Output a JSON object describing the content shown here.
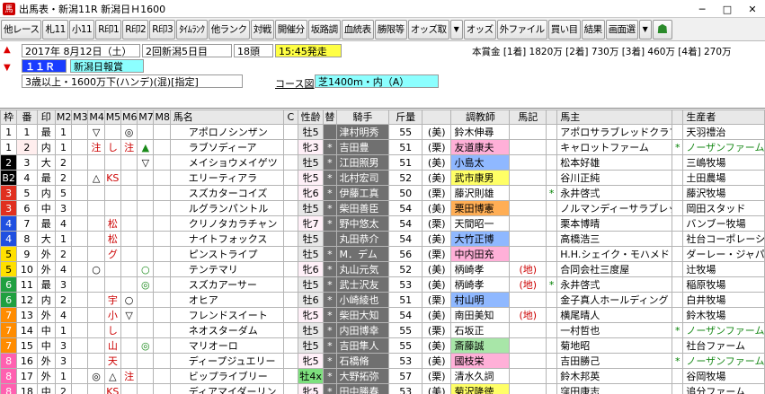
{
  "window": {
    "title": "出馬表・新潟11R 新潟日Ｈ1600",
    "minimize": "─",
    "maximize": "□",
    "close": "✕"
  },
  "toolbar": [
    "他レース",
    "札11",
    "小11",
    "R印1",
    "R印2",
    "R印3",
    "ﾀｲﾑﾗﾝｸ",
    "他ランク",
    "対戦",
    "開催分",
    "坂路調",
    "血統表",
    "勝限等",
    "オッズ取",
    "オッズ",
    "外ファイル",
    "買い目",
    "結果",
    "画面選"
  ],
  "race": {
    "date": "2017年 8月12日（土）",
    "meet": "2回新潟5日目",
    "heads": "18頭",
    "post_time": "15:45発走",
    "race_no": "１１Ｒ",
    "race_name": "新潟日報賞",
    "conditions": "3歳以上・1600万下(ハンデ)(混)[指定]",
    "course_label": "コース図",
    "course": "芝1400m・内（A）",
    "prize": "本賞金 [1着] 1820万 [2着] 730万 [3着] 460万 [4着] 270万"
  },
  "headers": [
    "枠",
    "番",
    "印",
    "M2",
    "M3",
    "M4",
    "M5",
    "M6",
    "M7",
    "M8",
    "馬名",
    "C",
    "性齢",
    "替",
    "騎手",
    "斤量",
    "",
    "調教師",
    "馬記",
    "",
    "馬主",
    "",
    "生産者"
  ],
  "colors": {
    "accent_red": "#cc0000",
    "frame1": "#ffffff",
    "frame2": "#000000",
    "frame3": "#e03020",
    "frame4": "#2050e0",
    "frame5": "#ffe000",
    "frame6": "#20a040",
    "frame7": "#ff8c00",
    "frame8": "#ff60b0"
  },
  "rows": [
    {
      "waku": "1",
      "num": "1",
      "in": "最",
      "m2": "1",
      "m3": "",
      "m4": "▽",
      "m5": "",
      "m6": "◎",
      "m7": "",
      "m8": "",
      "name": "アポロノシンザン",
      "c": "",
      "sex": "牡5",
      "chg": "",
      "jockey": "津村明秀",
      "kin": "55",
      "area": "(美)",
      "trainer": "鈴木伸尋",
      "tkg": "",
      "own_mark": "",
      "owner": "アポロサラブレッドクラブ",
      "prd_mark": "",
      "producer": "天羽禮治"
    },
    {
      "waku": "1",
      "num": "2",
      "in": "内",
      "m2": "1",
      "m3": "",
      "m4": "注",
      "m5": "し",
      "m6": "注",
      "m7": "▲",
      "m8": "",
      "name": "ラブソディーア",
      "c": "",
      "sex": "牝3",
      "chg": "*",
      "jockey": "吉田豊",
      "kin": "51",
      "area": "(栗)",
      "trainer": "友道康夫",
      "tkg": "",
      "own_mark": "",
      "owner": "キャロットファーム",
      "prd_mark": "*",
      "producer": "ノーザンファーム"
    },
    {
      "waku": "2",
      "num": "3",
      "in": "大",
      "m2": "2",
      "m3": "",
      "m4": "",
      "m5": "",
      "m6": "",
      "m7": "▽",
      "m8": "",
      "name": "メイショウメイゲツ",
      "c": "",
      "sex": "牡5",
      "chg": "*",
      "jockey": "江田照男",
      "kin": "51",
      "area": "(美)",
      "trainer": "小島太",
      "tkg": "",
      "own_mark": "",
      "owner": "松本好雄",
      "prd_mark": "",
      "producer": "三嶋牧場"
    },
    {
      "waku": "B2",
      "num": "4",
      "in": "最",
      "m2": "2",
      "m3": "",
      "m4": "△",
      "m5": "KS",
      "m6": "",
      "m7": "",
      "m8": "",
      "name": "エリーティアラ",
      "c": "",
      "sex": "牝5",
      "chg": "*",
      "jockey": "北村宏司",
      "kin": "52",
      "area": "(美)",
      "trainer": "武市康男",
      "tkg": "",
      "own_mark": "",
      "owner": "谷川正純",
      "prd_mark": "",
      "producer": "土田農場"
    },
    {
      "waku": "3",
      "num": "5",
      "in": "内",
      "m2": "5",
      "m3": "",
      "m4": "",
      "m5": "",
      "m6": "",
      "m7": "",
      "m8": "",
      "name": "スズカターコイズ",
      "c": "",
      "sex": "牝6",
      "chg": "*",
      "jockey": "伊藤工真",
      "kin": "50",
      "area": "(栗)",
      "trainer": "藤沢則雄",
      "tkg": "",
      "own_mark": "*",
      "owner": "永井啓弍",
      "prd_mark": "",
      "producer": "藤沢牧場"
    },
    {
      "waku": "3",
      "num": "6",
      "in": "中",
      "m2": "3",
      "m3": "",
      "m4": "",
      "m5": "",
      "m6": "",
      "m7": "",
      "m8": "",
      "name": "ルグランパントル",
      "c": "",
      "sex": "牡5",
      "chg": "*",
      "jockey": "柴田善臣",
      "kin": "54",
      "area": "(美)",
      "trainer": "栗田博憲",
      "tkg": "",
      "own_mark": "",
      "owner": "ノルマンディーサラブレッド",
      "prd_mark": "",
      "producer": "岡田スタッド"
    },
    {
      "waku": "4",
      "num": "7",
      "in": "最",
      "m2": "4",
      "m3": "",
      "m4": "",
      "m5": "松",
      "m6": "",
      "m7": "",
      "m8": "",
      "name": "クリノタカラチャン",
      "c": "",
      "sex": "牝7",
      "chg": "*",
      "jockey": "野中悠太",
      "kin": "54",
      "area": "(栗)",
      "trainer": "天間昭一",
      "tkg": "",
      "own_mark": "",
      "owner": "栗本博晴",
      "prd_mark": "",
      "producer": "バンブー牧場"
    },
    {
      "waku": "4",
      "num": "8",
      "in": "大",
      "m2": "1",
      "m3": "",
      "m4": "",
      "m5": "松",
      "m6": "",
      "m7": "",
      "m8": "",
      "name": "ナイトフォックス",
      "c": "",
      "sex": "牡5",
      "chg": "",
      "jockey": "丸田恭介",
      "kin": "54",
      "area": "(美)",
      "trainer": "大竹正博",
      "tkg": "",
      "own_mark": "",
      "owner": "高橋浩三",
      "prd_mark": "",
      "producer": "社台コーポレーション"
    },
    {
      "waku": "5",
      "num": "9",
      "in": "外",
      "m2": "2",
      "m3": "",
      "m4": "",
      "m5": "グ",
      "m6": "",
      "m7": "",
      "m8": "",
      "name": "ピンストライプ",
      "c": "",
      "sex": "牡5",
      "chg": "*",
      "jockey": "M．デム",
      "kin": "56",
      "area": "(栗)",
      "trainer": "中内田充",
      "tkg": "",
      "own_mark": "",
      "owner": "H.H.シェイク・モハメド",
      "prd_mark": "",
      "producer": "ダーレー・ジャパン"
    },
    {
      "waku": "5",
      "num": "10",
      "in": "外",
      "m2": "4",
      "m3": "",
      "m4": "○",
      "m5": "",
      "m6": "",
      "m7": "○",
      "m8": "",
      "name": "テンテマリ",
      "c": "",
      "sex": "牝6",
      "chg": "*",
      "jockey": "丸山元気",
      "kin": "52",
      "area": "(美)",
      "trainer": "柄崎孝",
      "tkg": "(地)",
      "own_mark": "",
      "owner": "合同会社三度屋",
      "prd_mark": "",
      "producer": "辻牧場"
    },
    {
      "waku": "6",
      "num": "11",
      "in": "最",
      "m2": "3",
      "m3": "",
      "m4": "",
      "m5": "",
      "m6": "",
      "m7": "◎",
      "m8": "",
      "name": "スズカアーサー",
      "c": "",
      "sex": "牡5",
      "chg": "*",
      "jockey": "武士沢友",
      "kin": "53",
      "area": "(美)",
      "trainer": "柄崎孝",
      "tkg": "(地)",
      "own_mark": "*",
      "owner": "永井啓弍",
      "prd_mark": "",
      "producer": "稲原牧場"
    },
    {
      "waku": "6",
      "num": "12",
      "in": "内",
      "m2": "2",
      "m3": "",
      "m4": "",
      "m5": "宇",
      "m6": "○",
      "m7": "",
      "m8": "",
      "name": "オヒア",
      "c": "",
      "sex": "牡6",
      "chg": "*",
      "jockey": "小崎綾也",
      "kin": "51",
      "area": "(栗)",
      "trainer": "村山明",
      "tkg": "",
      "own_mark": "",
      "owner": "金子真人ホールディング",
      "prd_mark": "",
      "producer": "白井牧場"
    },
    {
      "waku": "7",
      "num": "13",
      "in": "外",
      "m2": "4",
      "m3": "",
      "m4": "",
      "m5": "小",
      "m6": "▽",
      "m7": "",
      "m8": "",
      "name": "フレンドスイート",
      "c": "",
      "sex": "牝5",
      "chg": "*",
      "jockey": "柴田大知",
      "kin": "54",
      "area": "(美)",
      "trainer": "南田美知",
      "tkg": "(地)",
      "own_mark": "",
      "owner": "横尾晴人",
      "prd_mark": "",
      "producer": "鈴木牧場"
    },
    {
      "waku": "7",
      "num": "14",
      "in": "中",
      "m2": "1",
      "m3": "",
      "m4": "",
      "m5": "し",
      "m6": "",
      "m7": "",
      "m8": "",
      "name": "ネオスターダム",
      "c": "",
      "sex": "牡5",
      "chg": "*",
      "jockey": "内田博幸",
      "kin": "55",
      "area": "(栗)",
      "trainer": "石坂正",
      "tkg": "",
      "own_mark": "",
      "owner": "一村哲也",
      "prd_mark": "*",
      "producer": "ノーザンファーム"
    },
    {
      "waku": "7",
      "num": "15",
      "in": "中",
      "m2": "3",
      "m3": "",
      "m4": "",
      "m5": "山",
      "m6": "",
      "m7": "◎",
      "m8": "",
      "name": "マリオーロ",
      "c": "",
      "sex": "牡5",
      "chg": "*",
      "jockey": "吉田隼人",
      "kin": "55",
      "area": "(美)",
      "trainer": "斎藤誠",
      "tkg": "",
      "own_mark": "",
      "owner": "菊地昭",
      "prd_mark": "",
      "producer": "社台ファーム"
    },
    {
      "waku": "8",
      "num": "16",
      "in": "外",
      "m2": "3",
      "m3": "",
      "m4": "",
      "m5": "天",
      "m6": "",
      "m7": "",
      "m8": "",
      "name": "ディープジュエリー",
      "c": "",
      "sex": "牝5",
      "chg": "*",
      "jockey": "石橋脩",
      "kin": "53",
      "area": "(美)",
      "trainer": "國枝栄",
      "tkg": "",
      "own_mark": "",
      "owner": "吉田勝己",
      "prd_mark": "*",
      "producer": "ノーザンファーム"
    },
    {
      "waku": "8",
      "num": "17",
      "in": "外",
      "m2": "1",
      "m3": "",
      "m4": "◎",
      "m5": "△",
      "m6": "注",
      "m7": "",
      "m8": "",
      "name": "ビップライブリー",
      "c": "",
      "sex": "牡4x",
      "chg": "*",
      "jockey": "大野拓弥",
      "kin": "57",
      "area": "(栗)",
      "trainer": "清水久詞",
      "tkg": "",
      "own_mark": "",
      "owner": "鈴木邦英",
      "prd_mark": "",
      "producer": "谷岡牧場"
    },
    {
      "waku": "8",
      "num": "18",
      "in": "中",
      "m2": "2",
      "m3": "",
      "m4": "",
      "m5": "KS",
      "m6": "",
      "m7": "",
      "m8": "",
      "name": "ディアマイダーリン",
      "c": "",
      "sex": "牝5",
      "chg": "*",
      "jockey": "田中勝春",
      "kin": "53",
      "area": "(美)",
      "trainer": "菊沢隆徳",
      "tkg": "",
      "own_mark": "",
      "owner": "窪田康志",
      "prd_mark": "",
      "producer": "追分ファーム"
    }
  ]
}
